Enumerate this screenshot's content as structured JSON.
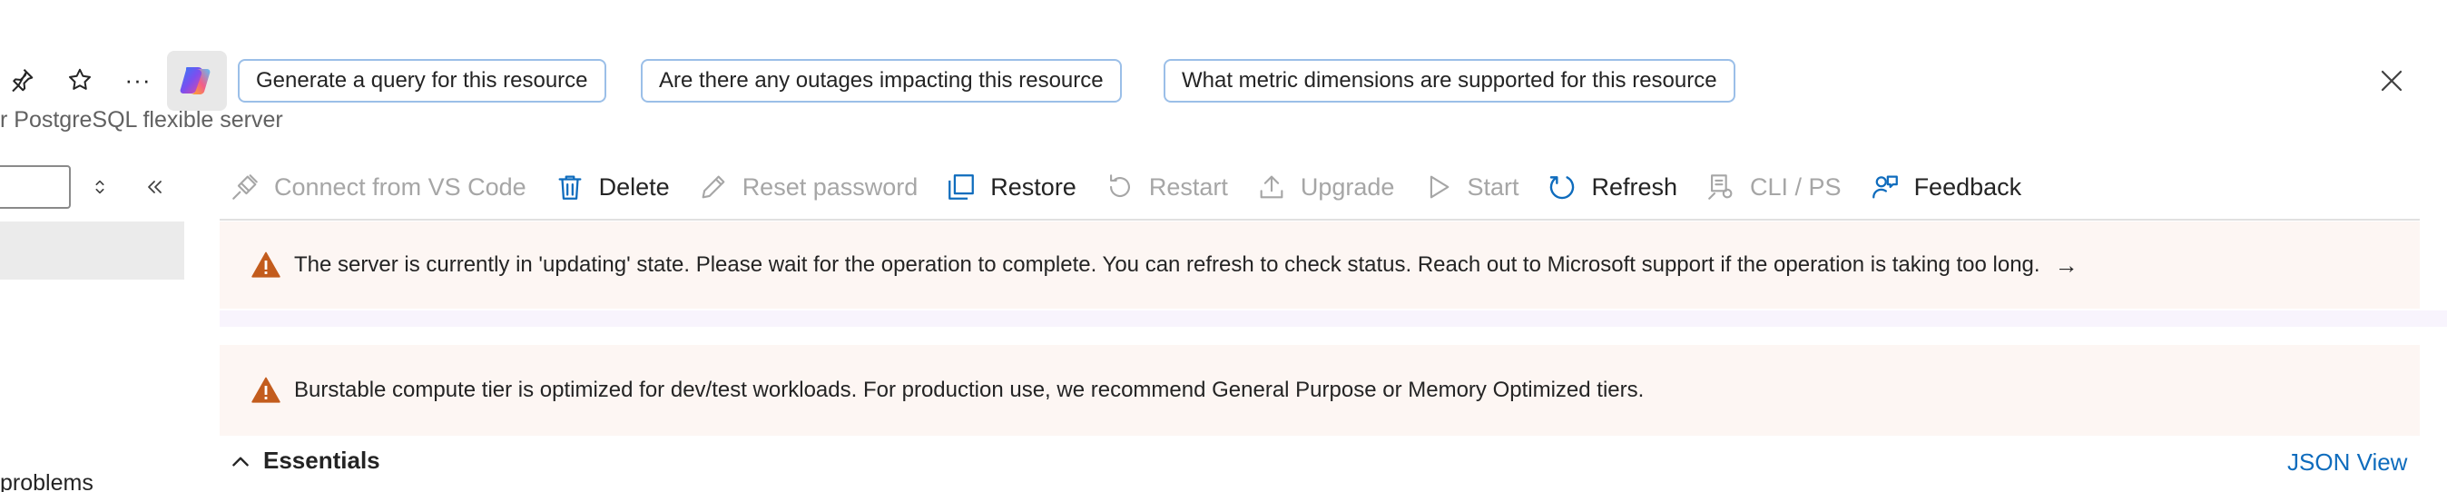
{
  "header": {
    "icons": [
      "pin-icon",
      "star-icon",
      "more-icon",
      "copilot-icon",
      "close-icon"
    ],
    "more_label": "···",
    "subtitle": "r PostgreSQL flexible server",
    "suggestions": [
      "Generate a query for this resource",
      "Are there any outages impacting this resource",
      "What metric dimensions are supported for this resource"
    ]
  },
  "sidebar": {
    "search_value": "",
    "partial_item": "problems"
  },
  "toolbar": {
    "items": [
      {
        "label": "Connect from VS Code",
        "icon": "connect-icon",
        "enabled": false
      },
      {
        "label": "Delete",
        "icon": "trash-icon",
        "enabled": true
      },
      {
        "label": "Reset password",
        "icon": "pencil-icon",
        "enabled": false
      },
      {
        "label": "Restore",
        "icon": "restore-icon",
        "enabled": true
      },
      {
        "label": "Restart",
        "icon": "restart-icon",
        "enabled": false
      },
      {
        "label": "Upgrade",
        "icon": "upload-icon",
        "enabled": false
      },
      {
        "label": "Start",
        "icon": "play-icon",
        "enabled": false
      },
      {
        "label": "Refresh",
        "icon": "refresh-icon",
        "enabled": true
      },
      {
        "label": "CLI / PS",
        "icon": "cli-icon",
        "enabled": false
      },
      {
        "label": "Feedback",
        "icon": "feedback-icon",
        "enabled": true
      }
    ]
  },
  "banners": {
    "updating": "The server is currently in 'updating' state. Please wait for the operation to complete.  You can refresh to check status. Reach out to Microsoft support if the operation is taking too long.",
    "updating_arrow": "→",
    "burstable": "Burstable compute tier is optimized for dev/test workloads. For production use, we recommend General Purpose or Memory Optimized tiers."
  },
  "essentials": {
    "label": "Essentials",
    "json_view": "JSON View"
  },
  "colors": {
    "accent": "#0f6cbd",
    "warning": "#c35c1d",
    "banner_bg": "#fdf6f3",
    "chip_border": "#9bbfe8"
  }
}
